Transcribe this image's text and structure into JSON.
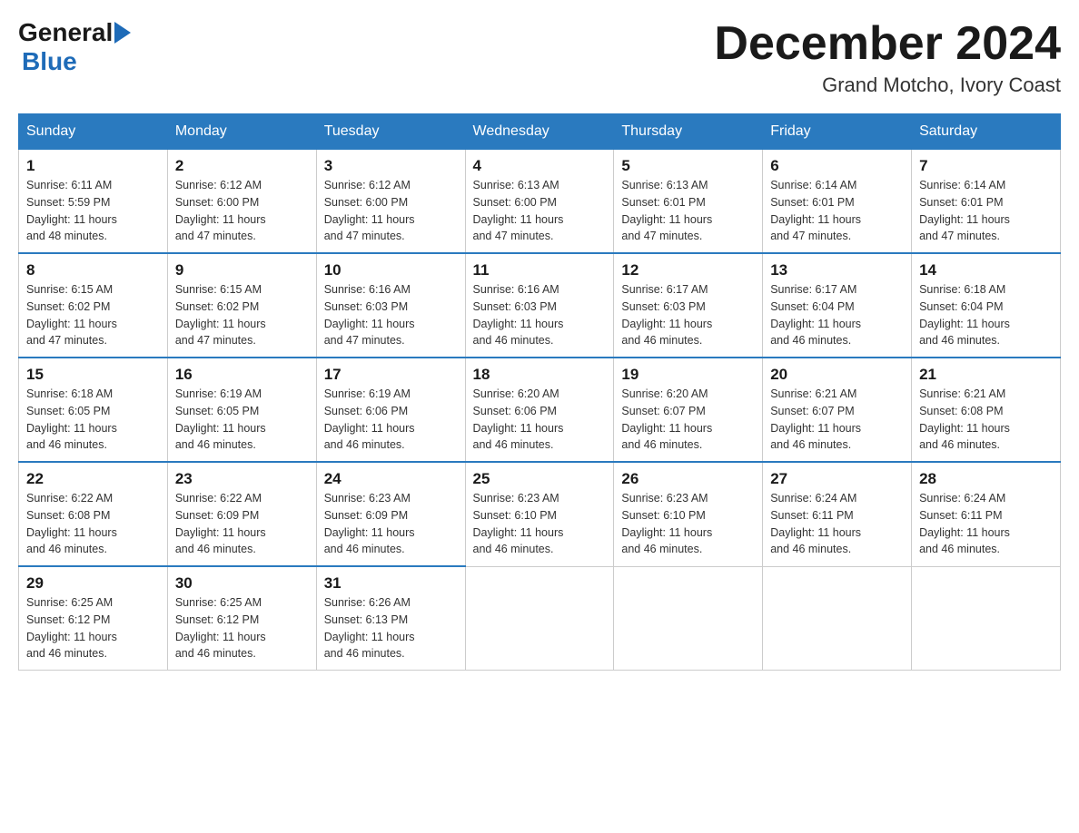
{
  "logo": {
    "general": "General",
    "blue": "Blue"
  },
  "header": {
    "title": "December 2024",
    "subtitle": "Grand Motcho, Ivory Coast"
  },
  "days_of_week": [
    "Sunday",
    "Monday",
    "Tuesday",
    "Wednesday",
    "Thursday",
    "Friday",
    "Saturday"
  ],
  "weeks": [
    [
      {
        "day": "1",
        "sunrise": "6:11 AM",
        "sunset": "5:59 PM",
        "daylight": "11 hours and 48 minutes."
      },
      {
        "day": "2",
        "sunrise": "6:12 AM",
        "sunset": "6:00 PM",
        "daylight": "11 hours and 47 minutes."
      },
      {
        "day": "3",
        "sunrise": "6:12 AM",
        "sunset": "6:00 PM",
        "daylight": "11 hours and 47 minutes."
      },
      {
        "day": "4",
        "sunrise": "6:13 AM",
        "sunset": "6:00 PM",
        "daylight": "11 hours and 47 minutes."
      },
      {
        "day": "5",
        "sunrise": "6:13 AM",
        "sunset": "6:01 PM",
        "daylight": "11 hours and 47 minutes."
      },
      {
        "day": "6",
        "sunrise": "6:14 AM",
        "sunset": "6:01 PM",
        "daylight": "11 hours and 47 minutes."
      },
      {
        "day": "7",
        "sunrise": "6:14 AM",
        "sunset": "6:01 PM",
        "daylight": "11 hours and 47 minutes."
      }
    ],
    [
      {
        "day": "8",
        "sunrise": "6:15 AM",
        "sunset": "6:02 PM",
        "daylight": "11 hours and 47 minutes."
      },
      {
        "day": "9",
        "sunrise": "6:15 AM",
        "sunset": "6:02 PM",
        "daylight": "11 hours and 47 minutes."
      },
      {
        "day": "10",
        "sunrise": "6:16 AM",
        "sunset": "6:03 PM",
        "daylight": "11 hours and 47 minutes."
      },
      {
        "day": "11",
        "sunrise": "6:16 AM",
        "sunset": "6:03 PM",
        "daylight": "11 hours and 46 minutes."
      },
      {
        "day": "12",
        "sunrise": "6:17 AM",
        "sunset": "6:03 PM",
        "daylight": "11 hours and 46 minutes."
      },
      {
        "day": "13",
        "sunrise": "6:17 AM",
        "sunset": "6:04 PM",
        "daylight": "11 hours and 46 minutes."
      },
      {
        "day": "14",
        "sunrise": "6:18 AM",
        "sunset": "6:04 PM",
        "daylight": "11 hours and 46 minutes."
      }
    ],
    [
      {
        "day": "15",
        "sunrise": "6:18 AM",
        "sunset": "6:05 PM",
        "daylight": "11 hours and 46 minutes."
      },
      {
        "day": "16",
        "sunrise": "6:19 AM",
        "sunset": "6:05 PM",
        "daylight": "11 hours and 46 minutes."
      },
      {
        "day": "17",
        "sunrise": "6:19 AM",
        "sunset": "6:06 PM",
        "daylight": "11 hours and 46 minutes."
      },
      {
        "day": "18",
        "sunrise": "6:20 AM",
        "sunset": "6:06 PM",
        "daylight": "11 hours and 46 minutes."
      },
      {
        "day": "19",
        "sunrise": "6:20 AM",
        "sunset": "6:07 PM",
        "daylight": "11 hours and 46 minutes."
      },
      {
        "day": "20",
        "sunrise": "6:21 AM",
        "sunset": "6:07 PM",
        "daylight": "11 hours and 46 minutes."
      },
      {
        "day": "21",
        "sunrise": "6:21 AM",
        "sunset": "6:08 PM",
        "daylight": "11 hours and 46 minutes."
      }
    ],
    [
      {
        "day": "22",
        "sunrise": "6:22 AM",
        "sunset": "6:08 PM",
        "daylight": "11 hours and 46 minutes."
      },
      {
        "day": "23",
        "sunrise": "6:22 AM",
        "sunset": "6:09 PM",
        "daylight": "11 hours and 46 minutes."
      },
      {
        "day": "24",
        "sunrise": "6:23 AM",
        "sunset": "6:09 PM",
        "daylight": "11 hours and 46 minutes."
      },
      {
        "day": "25",
        "sunrise": "6:23 AM",
        "sunset": "6:10 PM",
        "daylight": "11 hours and 46 minutes."
      },
      {
        "day": "26",
        "sunrise": "6:23 AM",
        "sunset": "6:10 PM",
        "daylight": "11 hours and 46 minutes."
      },
      {
        "day": "27",
        "sunrise": "6:24 AM",
        "sunset": "6:11 PM",
        "daylight": "11 hours and 46 minutes."
      },
      {
        "day": "28",
        "sunrise": "6:24 AM",
        "sunset": "6:11 PM",
        "daylight": "11 hours and 46 minutes."
      }
    ],
    [
      {
        "day": "29",
        "sunrise": "6:25 AM",
        "sunset": "6:12 PM",
        "daylight": "11 hours and 46 minutes."
      },
      {
        "day": "30",
        "sunrise": "6:25 AM",
        "sunset": "6:12 PM",
        "daylight": "11 hours and 46 minutes."
      },
      {
        "day": "31",
        "sunrise": "6:26 AM",
        "sunset": "6:13 PM",
        "daylight": "11 hours and 46 minutes."
      },
      null,
      null,
      null,
      null
    ]
  ],
  "labels": {
    "sunrise": "Sunrise:",
    "sunset": "Sunset:",
    "daylight": "Daylight:"
  }
}
